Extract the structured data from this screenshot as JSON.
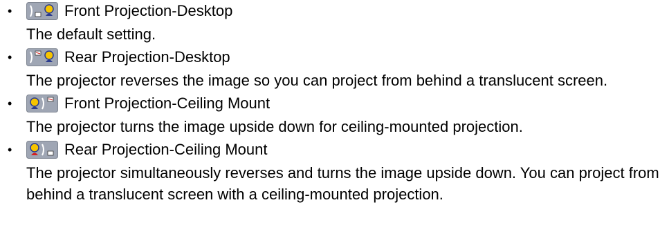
{
  "items": [
    {
      "title": "Front Projection-Desktop",
      "description": "The default setting.",
      "icon": "front-projection-desktop-icon"
    },
    {
      "title": "Rear Projection-Desktop",
      "description": "The projector reverses the image so you can project from behind a translucent screen.",
      "icon": "rear-projection-desktop-icon"
    },
    {
      "title": "Front Projection-Ceiling Mount",
      "description": "The projector turns the image upside down for ceiling-mounted projection.",
      "icon": "front-projection-ceiling-icon"
    },
    {
      "title": "Rear Projection-Ceiling Mount",
      "description": "The projector simultaneously reverses and turns the image upside down. You can project from behind a translucent screen with a ceiling-mounted projection.",
      "icon": "rear-projection-ceiling-icon"
    }
  ],
  "colors": {
    "icon_bg": "#9fa6b4",
    "icon_border": "#5e6470",
    "person_head": "#f6c400",
    "person_outline": "#2a3b8f",
    "person_body_red": "#d42020",
    "projector_white": "#ffffff"
  }
}
